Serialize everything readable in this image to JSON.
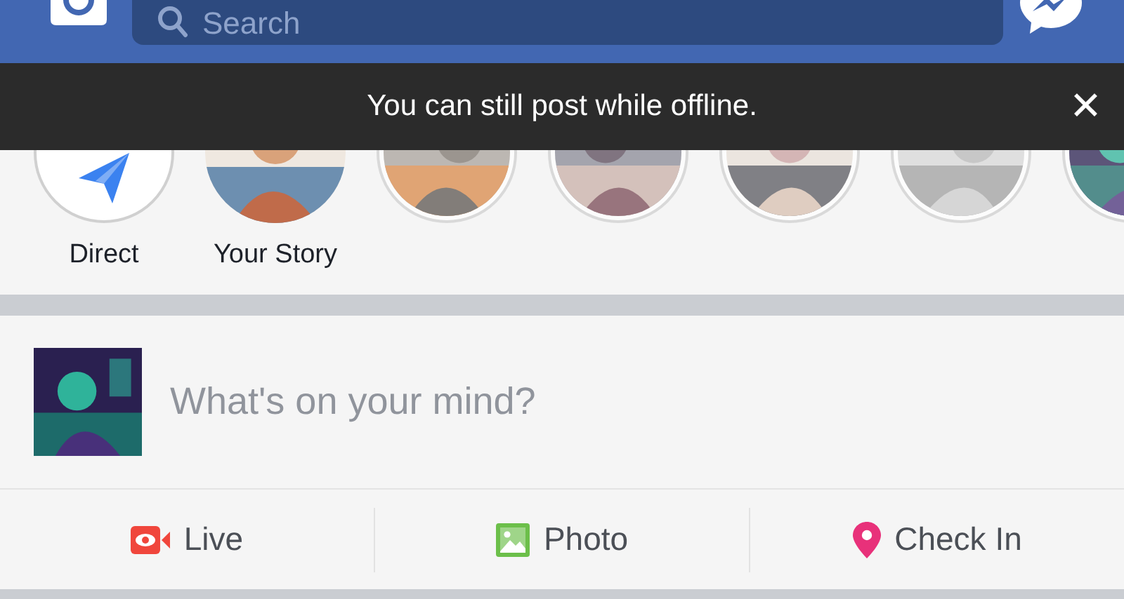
{
  "top_bar": {
    "search": {
      "placeholder": "Search"
    }
  },
  "banner": {
    "message": "You can still post while offline.",
    "close": "✕"
  },
  "stories": [
    {
      "kind": "direct",
      "label": "Direct"
    },
    {
      "kind": "picture",
      "label": "Your Story"
    },
    {
      "kind": "picture"
    },
    {
      "kind": "picture"
    },
    {
      "kind": "picture"
    },
    {
      "kind": "picture"
    },
    {
      "kind": "picture"
    }
  ],
  "composer": {
    "placeholder": "What's on your mind?"
  },
  "actions": [
    {
      "kind": "live",
      "label": "Live"
    },
    {
      "label": "Photo"
    },
    {
      "kind": "checkin",
      "label": "Check In"
    }
  ]
}
